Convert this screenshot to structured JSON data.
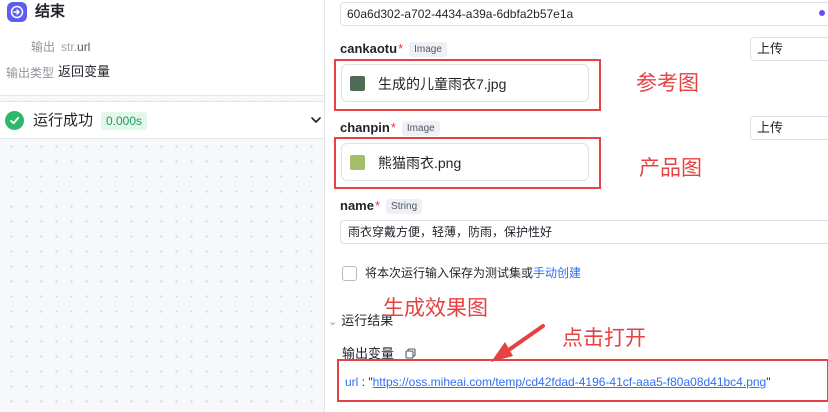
{
  "end_node": {
    "title": "结束",
    "output_label": "输出",
    "output_prefix": "str.",
    "output_value": "url",
    "output_type_label": "输出类型",
    "output_type_value": "返回变量"
  },
  "run_status": {
    "title": "运行成功",
    "duration": "0.000s"
  },
  "form": {
    "id_value": "60a6d302-a702-4434-a39a-6dbfa2b57e1a",
    "params": [
      {
        "name": "cankaotu",
        "required_mark": "*",
        "type": "Image",
        "source": "上传",
        "file_name": "生成的儿童雨衣7.jpg",
        "file_thumb_color": "#4f6b53"
      },
      {
        "name": "chanpin",
        "required_mark": "*",
        "type": "Image",
        "source": "上传",
        "file_name": "熊猫雨衣.png",
        "file_thumb_color": "#a4be6a"
      },
      {
        "name": "name",
        "required_mark": "*",
        "type": "String",
        "value": "雨衣穿戴方便，轻薄，防雨，保护性好"
      }
    ],
    "save_text": "将本次运行输入保存为测试集或",
    "save_link": "手动创建"
  },
  "result": {
    "section_title": "运行结果",
    "output_vars_title": "输出变量",
    "key": "url",
    "separator": " : ",
    "quote_open": "\"",
    "link": "https://oss.miheai.com/temp/cd42fdad-4196-41cf-aaa5-f80a08d41bc4.png",
    "quote_close": "\""
  },
  "annotations": {
    "ref_image": "参考图",
    "product_image": "产品图",
    "generate_result": "生成效果图",
    "click_open": "点击打开"
  },
  "colors": {
    "accent": "#5f5cf0",
    "success": "#2fb86b",
    "annotation_red": "#e54343",
    "link_blue": "#2d6ff6"
  }
}
